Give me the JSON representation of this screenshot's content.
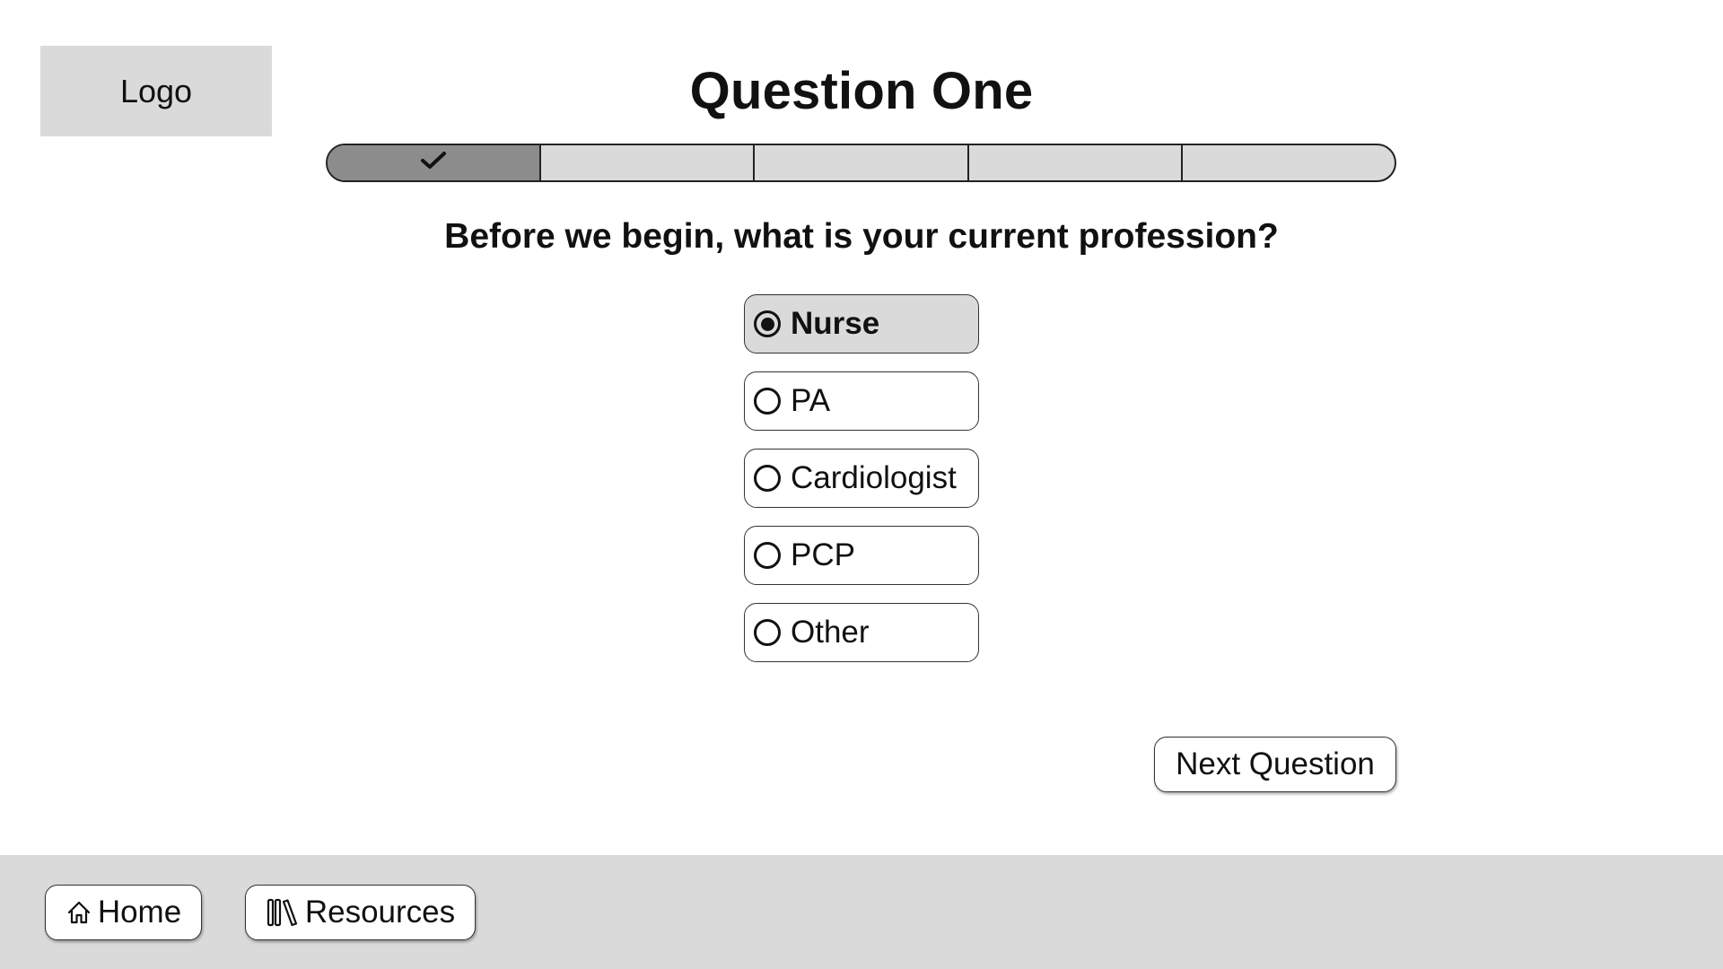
{
  "logo": {
    "label": "Logo"
  },
  "header": {
    "title": "Question One"
  },
  "progress": {
    "total_steps": 5,
    "completed_steps": 1,
    "check_icon": "checkmark-icon"
  },
  "question": {
    "text": "Before we begin, what is your current profession?",
    "options": [
      {
        "label": "Nurse",
        "selected": true
      },
      {
        "label": "PA",
        "selected": false
      },
      {
        "label": "Cardiologist",
        "selected": false
      },
      {
        "label": "PCP",
        "selected": false
      },
      {
        "label": "Other",
        "selected": false
      }
    ]
  },
  "actions": {
    "next_label": "Next Question"
  },
  "footer": {
    "home_label": "Home",
    "home_icon": "home-icon",
    "resources_label": "Resources",
    "resources_icon": "library-icon"
  },
  "colors": {
    "panel_gray": "#dadada",
    "progress_complete": "#8c8c8c",
    "text": "#111111"
  }
}
